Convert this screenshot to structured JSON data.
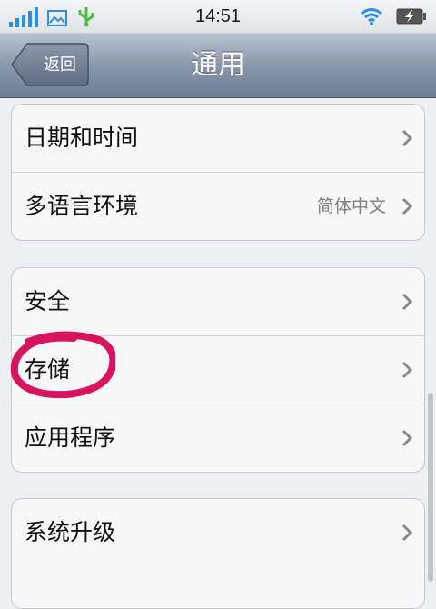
{
  "status_bar": {
    "time": "14:51",
    "icons": [
      "signal-icon",
      "image-icon",
      "usb-icon",
      "wifi-icon",
      "battery-charging-icon"
    ]
  },
  "nav": {
    "back_label": "返回",
    "title": "通用"
  },
  "groups": [
    {
      "rows": [
        {
          "label": "日期和时间"
        },
        {
          "label": "多语言环境",
          "value": "简体中文"
        }
      ]
    },
    {
      "rows": [
        {
          "label": "安全"
        },
        {
          "label": "存储"
        },
        {
          "label": "应用程序"
        }
      ]
    },
    {
      "rows": [
        {
          "label": "系统升级"
        }
      ]
    }
  ],
  "colors": {
    "accent_blue": "#2b8fe8",
    "usb_green": "#4dbf3a",
    "annotation": "#d8145e",
    "nav_dark": "#6f7e96"
  }
}
